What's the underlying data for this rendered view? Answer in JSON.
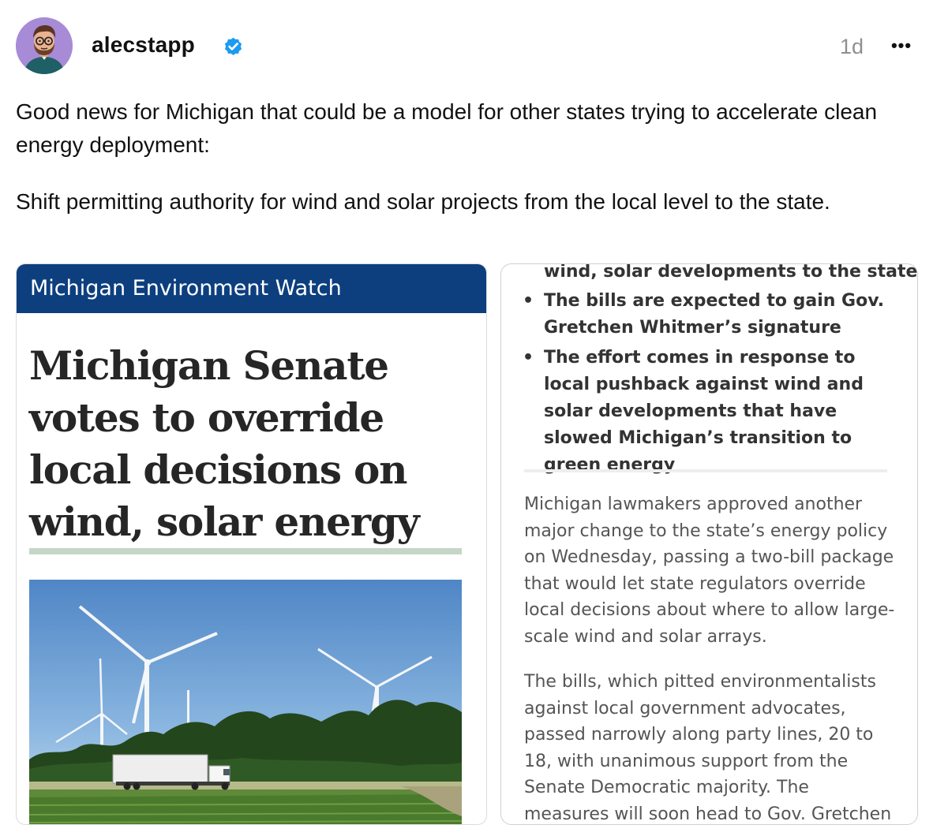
{
  "post": {
    "username": "alecstapp",
    "timestamp": "1d",
    "more_label": "•••",
    "paragraphs": [
      "Good news for Michigan that could be a model for other states trying to accelerate clean energy deployment:",
      "Shift permitting authority for wind and solar projects from the local level to the state."
    ]
  },
  "icons": {
    "avatar": "bearded-man-with-glasses-avatar",
    "verified": "blue-verified-badge",
    "more": "horizontal-ellipsis-icon"
  },
  "colors": {
    "verified": "#1d9bf0",
    "source_bar": "#0d3f7f",
    "avatar_bg": "#a78bd6"
  },
  "article_left": {
    "source": "Michigan Environment Watch",
    "headline_lines": [
      "Michigan Senate",
      "votes to override",
      "local decisions on",
      "wind, solar energy"
    ],
    "photo": "wind-turbines-farm-field-with-truck-photo"
  },
  "article_right": {
    "bullet_continuation": "wind, solar developments to the state",
    "bullets": [
      "The bills are expected to gain Gov. Gretchen Whitmer’s signature",
      "The effort comes in response to local pushback against wind and solar developments that have slowed Michigan’s transition to green energy"
    ],
    "paragraphs": [
      "Michigan lawmakers approved another major change to the state’s energy policy on Wednesday, passing a two-bill package that would let state regulators override local decisions about where to allow large-scale wind and solar arrays.",
      "The bills, which pitted environmentalists against local government advocates, passed narrowly along party lines, 20 to 18, with unanimous support from the Senate Democratic majority. The measures will soon head to Gov. Gretchen"
    ]
  }
}
